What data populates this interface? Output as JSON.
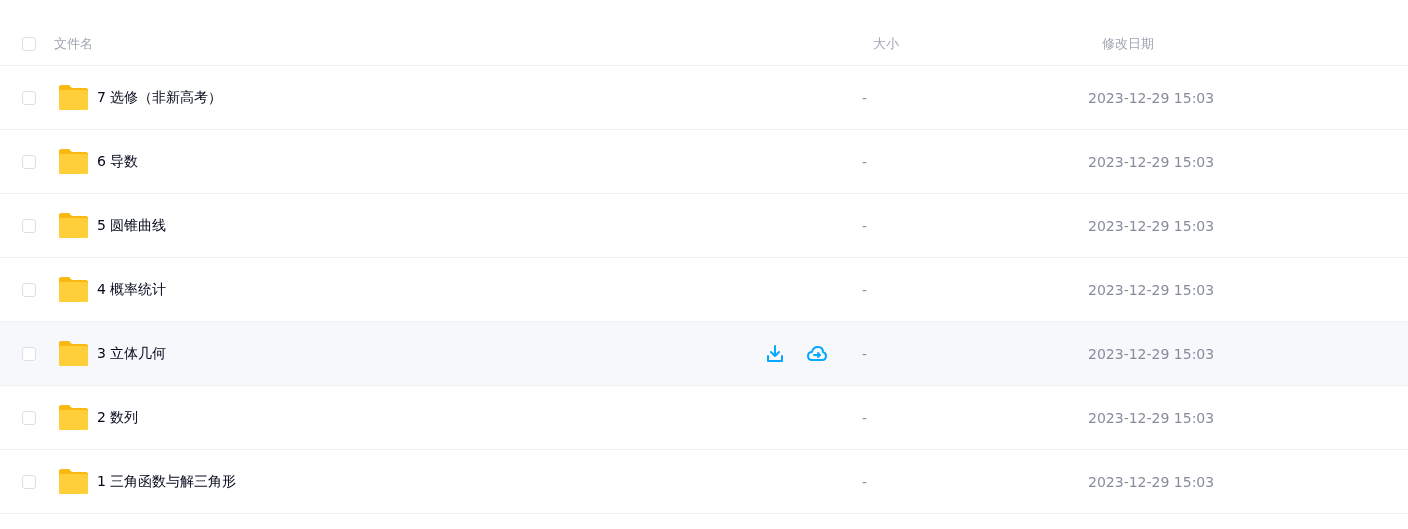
{
  "table": {
    "columns": [
      {
        "label": "文件名"
      },
      {
        "label": "大小"
      },
      {
        "label": "修改日期"
      }
    ],
    "header_checked": false,
    "rows": [
      {
        "name": "7 选修（非新高考）",
        "size": "-",
        "modified": "2023-12-29 15:03",
        "checked": false,
        "hovered": false
      },
      {
        "name": "6 导数",
        "size": "-",
        "modified": "2023-12-29 15:03",
        "checked": false,
        "hovered": false
      },
      {
        "name": "5 圆锥曲线",
        "size": "-",
        "modified": "2023-12-29 15:03",
        "checked": false,
        "hovered": false
      },
      {
        "name": "4 概率统计",
        "size": "-",
        "modified": "2023-12-29 15:03",
        "checked": false,
        "hovered": false
      },
      {
        "name": "3 立体几何",
        "size": "-",
        "modified": "2023-12-29 15:03",
        "checked": false,
        "hovered": true
      },
      {
        "name": "2 数列",
        "size": "-",
        "modified": "2023-12-29 15:03",
        "checked": false,
        "hovered": false
      },
      {
        "name": "1 三角函数与解三角形",
        "size": "-",
        "modified": "2023-12-29 15:03",
        "checked": false,
        "hovered": false
      }
    ]
  }
}
